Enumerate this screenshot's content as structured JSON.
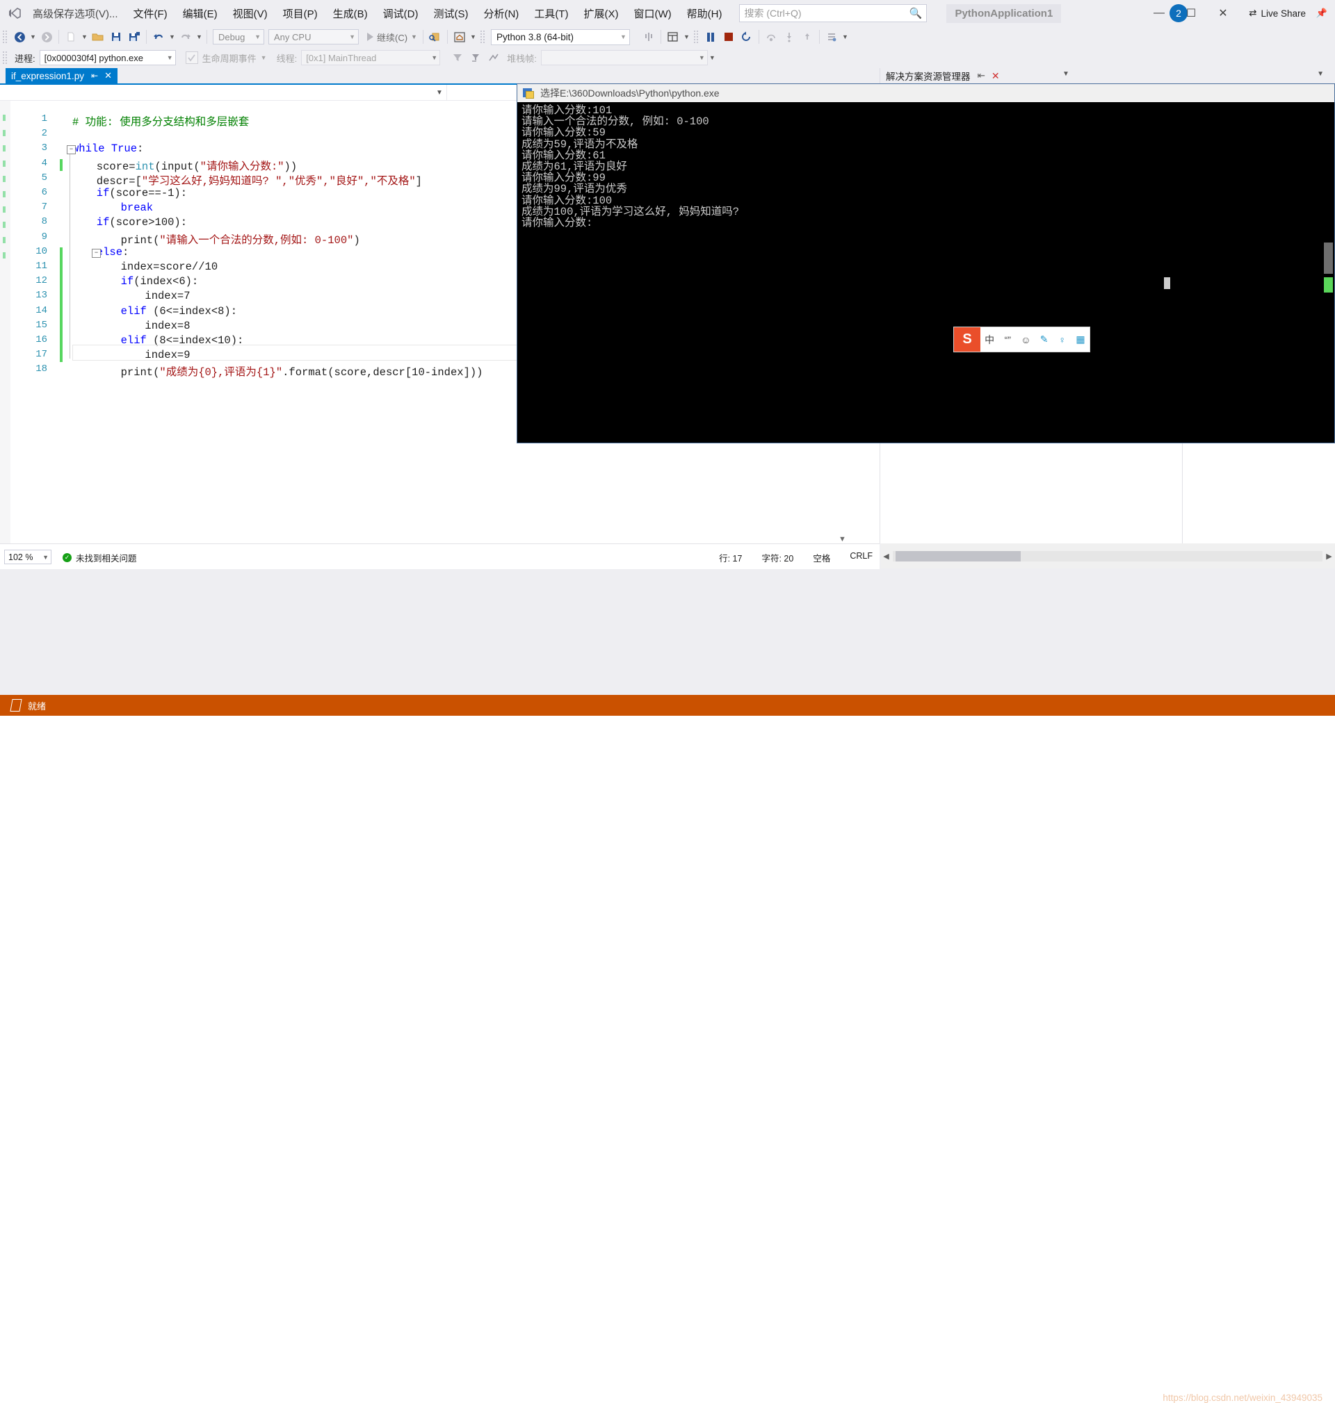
{
  "window": {
    "project_name": "PythonApplication1",
    "notification_count": "2",
    "live_share": "Live Share",
    "minimize": "—",
    "maximize": "☐",
    "close": "✕",
    "pin": "⚐"
  },
  "menu": {
    "items": [
      "高级保存选项(V)...",
      "文件(F)",
      "编辑(E)",
      "视图(V)",
      "项目(P)",
      "生成(B)",
      "调试(D)",
      "测试(S)",
      "分析(N)",
      "工具(T)",
      "扩展(X)",
      "窗口(W)",
      "帮助(H)"
    ]
  },
  "search": {
    "placeholder": "搜索 (Ctrl+Q)",
    "icon": "search-icon"
  },
  "toolbar": {
    "back_icon": "navigate-back-icon",
    "forward_icon": "navigate-forward-icon",
    "new_item_icon": "new-file-icon",
    "open_icon": "open-folder-icon",
    "save_icon": "save-icon",
    "save_all_icon": "save-all-icon",
    "undo_icon": "undo-icon",
    "redo_icon": "redo-icon",
    "config_value": "Debug",
    "platform_value": "Any CPU",
    "continue_label": "继续(C)",
    "attach_icon": "attach-process-icon",
    "home_icon": "start-page-icon",
    "interpreter_value": "Python 3.8 (64-bit)",
    "breakall_icon": "break-all-icon",
    "window_icon": "window-layout-icon",
    "pause_icon": "pause-icon",
    "stop_icon": "stop-icon",
    "restart_icon": "restart-icon",
    "stepover_icon": "step-over-icon",
    "stepinto_icon": "step-into-icon",
    "stepout_icon": "step-out-icon",
    "thread_icon": "thread-icon"
  },
  "debugbar": {
    "process_label": "进程:",
    "process_value": "[0x000030f4] python.exe",
    "lifecycle_label": "生命周期事件",
    "thread_label": "线程:",
    "thread_value": "[0x1] MainThread",
    "stack_label": "堆栈帧:",
    "stack_value": ""
  },
  "tabs": {
    "document": "if_expression1.py",
    "solution_explorer": "解决方案资源管理器"
  },
  "editor": {
    "lines": [
      {
        "n": "1",
        "indent": 0,
        "tokens": [
          {
            "t": "cmt",
            "v": "# 功能: 使用多分支结构和多层嵌套"
          }
        ]
      },
      {
        "n": "2",
        "indent": 0,
        "tokens": []
      },
      {
        "n": "3",
        "indent": 0,
        "tokens": [
          {
            "t": "kw",
            "v": "while"
          },
          {
            "t": "txt",
            "v": " "
          },
          {
            "t": "kw",
            "v": "True"
          },
          {
            "t": "txt",
            "v": ":"
          }
        ]
      },
      {
        "n": "4",
        "indent": 1,
        "tokens": [
          {
            "t": "txt",
            "v": "score="
          },
          {
            "t": "fn",
            "v": "int"
          },
          {
            "t": "txt",
            "v": "(input("
          },
          {
            "t": "str",
            "v": "\"请你输入分数:\""
          },
          {
            "t": "txt",
            "v": "))"
          }
        ]
      },
      {
        "n": "5",
        "indent": 1,
        "tokens": [
          {
            "t": "txt",
            "v": "descr=["
          },
          {
            "t": "str",
            "v": "\"学习这么好,妈妈知道吗? \",\"优秀\",\"良好\",\"不及格\""
          },
          {
            "t": "txt",
            "v": "]"
          }
        ]
      },
      {
        "n": "6",
        "indent": 1,
        "tokens": [
          {
            "t": "kw",
            "v": "if"
          },
          {
            "t": "txt",
            "v": "(score==-1):"
          }
        ]
      },
      {
        "n": "7",
        "indent": 2,
        "tokens": [
          {
            "t": "kw",
            "v": "break"
          }
        ]
      },
      {
        "n": "8",
        "indent": 1,
        "tokens": [
          {
            "t": "kw",
            "v": "if"
          },
          {
            "t": "txt",
            "v": "(score>100):"
          }
        ]
      },
      {
        "n": "9",
        "indent": 2,
        "tokens": [
          {
            "t": "txt",
            "v": "print("
          },
          {
            "t": "str",
            "v": "\"请输入一个合法的分数,例如: 0-100\""
          },
          {
            "t": "txt",
            "v": ")"
          }
        ]
      },
      {
        "n": "10",
        "indent": 1,
        "tokens": [
          {
            "t": "kw",
            "v": "else"
          },
          {
            "t": "txt",
            "v": ":"
          }
        ]
      },
      {
        "n": "11",
        "indent": 2,
        "tokens": [
          {
            "t": "txt",
            "v": "index=score//10"
          }
        ]
      },
      {
        "n": "12",
        "indent": 2,
        "tokens": [
          {
            "t": "kw",
            "v": "if"
          },
          {
            "t": "txt",
            "v": "(index<6):"
          }
        ]
      },
      {
        "n": "13",
        "indent": 3,
        "tokens": [
          {
            "t": "txt",
            "v": "index=7"
          }
        ]
      },
      {
        "n": "14",
        "indent": 2,
        "tokens": [
          {
            "t": "kw",
            "v": "elif"
          },
          {
            "t": "txt",
            "v": " (6<=index<8):"
          }
        ]
      },
      {
        "n": "15",
        "indent": 3,
        "tokens": [
          {
            "t": "txt",
            "v": "index=8"
          }
        ]
      },
      {
        "n": "16",
        "indent": 2,
        "tokens": [
          {
            "t": "kw",
            "v": "elif"
          },
          {
            "t": "txt",
            "v": " (8<=index<10):"
          }
        ]
      },
      {
        "n": "17",
        "indent": 3,
        "tokens": [
          {
            "t": "txt",
            "v": "index=9"
          }
        ]
      },
      {
        "n": "18",
        "indent": 2,
        "tokens": [
          {
            "t": "txt",
            "v": "print("
          },
          {
            "t": "str",
            "v": "\"成绩为{0},评语为{1}\""
          },
          {
            "t": "txt",
            "v": ".format(score,descr[10-index]))"
          }
        ]
      }
    ]
  },
  "console": {
    "title": "选择E:\\360Downloads\\Python\\python.exe",
    "icon": "console-window-icon",
    "output": "请你输入分数:101\n请输入一个合法的分数, 例如: 0-100\n请你输入分数:59\n成绩为59,评语为不及格\n请你输入分数:61\n成绩为61,评语为良好\n请你输入分数:99\n成绩为99,评语为优秀\n请你输入分数:100\n成绩为100,评语为学习这么好, 妈妈知道吗?\n请你输入分数:"
  },
  "ime": {
    "logo": "S",
    "mode": "中",
    "punct": "“”",
    "emoji": "☺",
    "pen": "✎",
    "mic": "♀",
    "grid": "▦"
  },
  "status": {
    "zoom": "102 %",
    "issues": "未找到相关问题",
    "line_label": "行: 17",
    "col_label": "字符: 20",
    "space_label": "空格",
    "eol_label": "CRLF",
    "ready": "就绪",
    "watermark": "https://blog.csdn.net/weixin_43949035"
  },
  "colors": {
    "accent": "#007acc",
    "status_bar": "#ca5100",
    "keyword": "#0000ff",
    "string": "#a31515",
    "comment": "#008000",
    "function": "#2b91af",
    "chrome": "#eeeef2"
  }
}
